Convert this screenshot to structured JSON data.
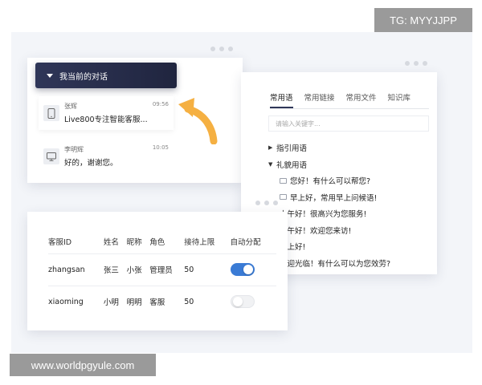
{
  "conversation_panel": {
    "header": "我当前的对话",
    "items": [
      {
        "name": "张辉",
        "message": "Live800专注智能客服...",
        "time": "09:56",
        "device": "phone-icon"
      },
      {
        "name": "李明辉",
        "message": "好的，谢谢您。",
        "time": "10:05",
        "device": "monitor-icon"
      }
    ]
  },
  "phrases_panel": {
    "tabs": [
      "常用语",
      "常用链接",
      "常用文件",
      "知识库"
    ],
    "active_tab": "常用语",
    "search_placeholder": "请输入关键字...",
    "groups": [
      {
        "label": "指引用语",
        "expanded": false
      },
      {
        "label": "礼貌用语",
        "expanded": true
      }
    ],
    "phrases": [
      "您好！有什么可以帮您?",
      "早上好，常用早上问候语!",
      "上午好！很高兴为您服务!",
      "下午好！欢迎您来访!",
      "晚上好!",
      "欢迎光临！有什么可以为您效劳?"
    ]
  },
  "table_panel": {
    "headers": [
      "客服ID",
      "姓名",
      "昵称",
      "角色",
      "接待上限",
      "自动分配"
    ],
    "rows": [
      {
        "id": "zhangsan",
        "name": "张三",
        "nickname": "小张",
        "role": "管理员",
        "limit": "50",
        "auto_assign": true
      },
      {
        "id": "xiaoming",
        "name": "小明",
        "nickname": "明明",
        "role": "客服",
        "limit": "50",
        "auto_assign": false
      }
    ]
  },
  "watermarks": {
    "top_right": "TG: MYYJJPP",
    "bottom_left": "www.worldpgyule.com"
  },
  "colors": {
    "header_dark": "#2f3658",
    "toggle_on": "#3a7bd5",
    "arrow": "#f5b042"
  }
}
